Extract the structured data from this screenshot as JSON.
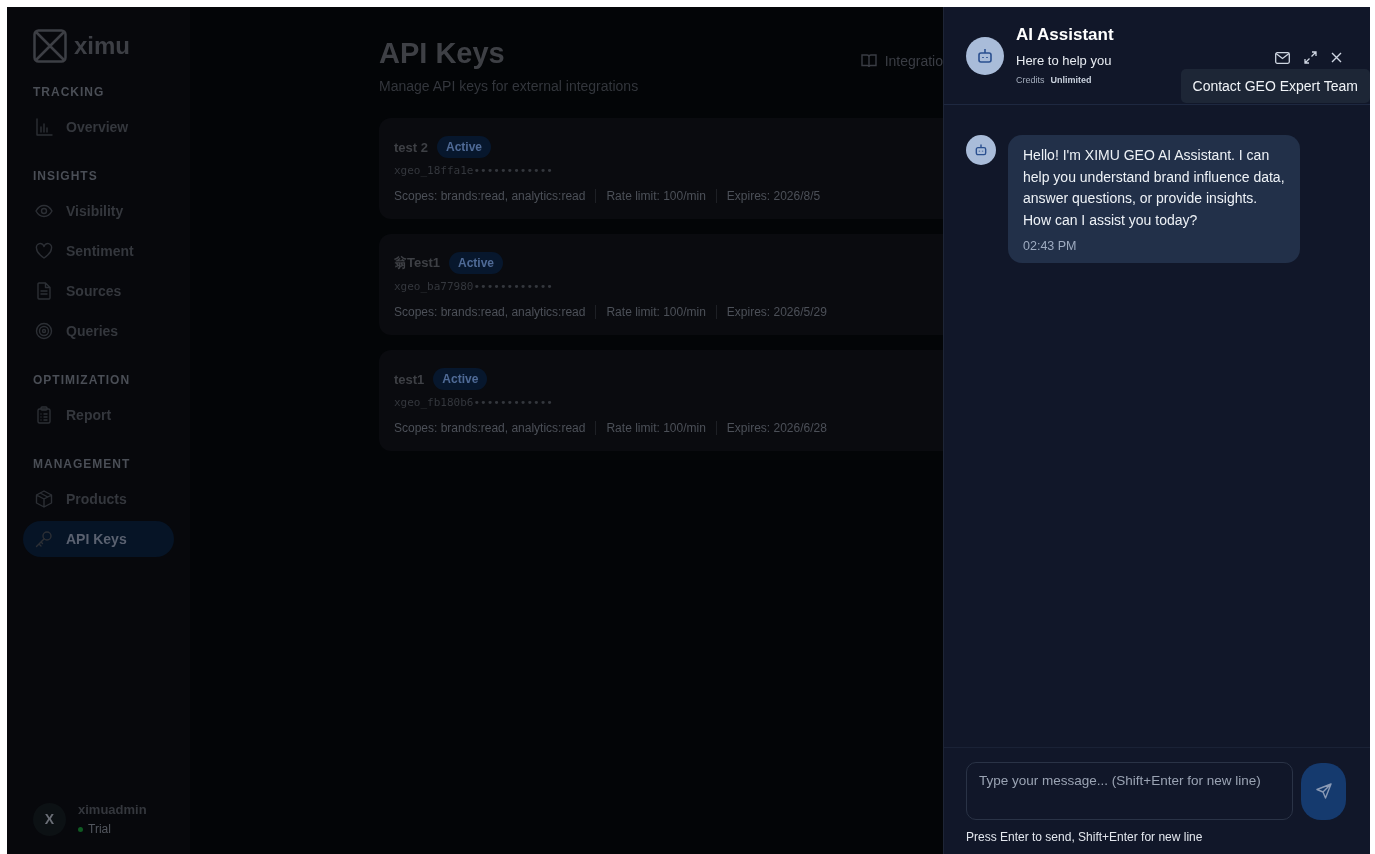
{
  "sidebar": {
    "logo": "ximu",
    "sections": [
      {
        "title": "TRACKING",
        "items": [
          {
            "label": "Overview",
            "selected": false
          }
        ]
      },
      {
        "title": "INSIGHTS",
        "items": [
          {
            "label": "Visibility",
            "selected": false
          },
          {
            "label": "Sentiment",
            "selected": false
          },
          {
            "label": "Sources",
            "selected": false
          },
          {
            "label": "Queries",
            "selected": false
          }
        ]
      },
      {
        "title": "OPTIMIZATION",
        "items": [
          {
            "label": "Report",
            "selected": false
          }
        ]
      },
      {
        "title": "MANAGEMENT",
        "items": [
          {
            "label": "Products",
            "selected": false
          },
          {
            "label": "API Keys",
            "selected": true
          }
        ]
      }
    ],
    "user": {
      "avatar": "X",
      "name": "ximuadmin",
      "plan": "Trial",
      "color": "#0f5a22"
    }
  },
  "page": {
    "title": "API Keys",
    "subtitle": "Manage API keys for external integrations",
    "integration_button": "Integratio",
    "keys": [
      {
        "name": "test 2",
        "status": "Active",
        "key": "xgeo_18ffa1e••••••••••••",
        "scopes": "Scopes: brands:read, analytics:read",
        "rate_limit": "Rate limit: 100/min",
        "expires": "Expires: 2026/8/5"
      },
      {
        "name": "翁Test1",
        "status": "Active",
        "key": "xgeo_ba77980••••••••••••",
        "scopes": "Scopes: brands:read, analytics:read",
        "rate_limit": "Rate limit: 100/min",
        "expires": "Expires: 2026/5/29"
      },
      {
        "name": "test1",
        "status": "Active",
        "key": "xgeo_fb180b6••••••••••••",
        "scopes": "Scopes: brands:read, analytics:read",
        "rate_limit": "Rate limit: 100/min",
        "expires": "Expires: 2026/6/28"
      }
    ]
  },
  "chat": {
    "title": "AI Assistant",
    "subtitle": "Here to help you",
    "credits_label": "Credits",
    "credits_value": "Unlimited",
    "tooltip": "Contact GEO Expert Team",
    "messages": [
      {
        "text": "Hello! I'm XIMU GEO AI Assistant. I can help you understand brand influence data, answer questions, or provide insights. How can I assist you today?",
        "time": "02:43 PM"
      }
    ],
    "input": {
      "placeholder": "Type your message... (Shift+Enter for new line)"
    },
    "hint": "Press Enter to send, Shift+Enter for new line"
  }
}
